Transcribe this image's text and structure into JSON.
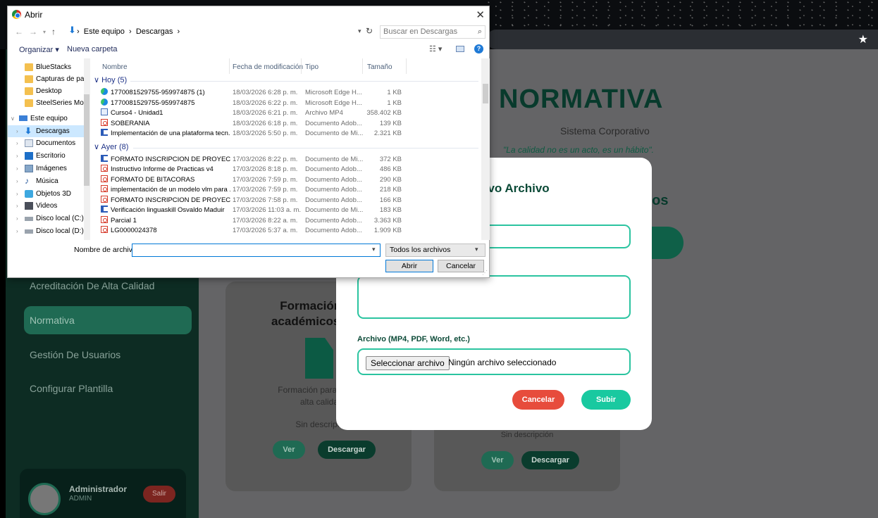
{
  "dialog": {
    "title": "Abrir",
    "path": [
      "Este equipo",
      "Descargas"
    ],
    "search_placeholder": "Buscar en Descargas",
    "toolbar": {
      "organize": "Organizar ▾",
      "new_folder": "Nueva carpeta"
    },
    "nav_items": [
      {
        "label": "BlueStacks",
        "icon": "folder-icon"
      },
      {
        "label": "Capturas de pan",
        "icon": "folder-icon"
      },
      {
        "label": "Desktop",
        "icon": "folder-icon"
      },
      {
        "label": "SteelSeries Mom",
        "icon": "folder-icon"
      },
      {
        "label": "Este equipo",
        "icon": "computer-icon"
      },
      {
        "label": "Descargas",
        "icon": "downloads-icon",
        "selected": true
      },
      {
        "label": "Documentos",
        "icon": "documents-icon"
      },
      {
        "label": "Escritorio",
        "icon": "desktop-icon"
      },
      {
        "label": "Imágenes",
        "icon": "pictures-icon"
      },
      {
        "label": "Música",
        "icon": "music-icon"
      },
      {
        "label": "Objetos 3D",
        "icon": "3d-objects-icon"
      },
      {
        "label": "Videos",
        "icon": "videos-icon"
      },
      {
        "label": "Disco local (C:)",
        "icon": "drive-icon"
      },
      {
        "label": "Disco local (D:)",
        "icon": "drive-icon"
      }
    ],
    "columns": {
      "name": "Nombre",
      "date": "Fecha de modificación",
      "type": "Tipo",
      "size": "Tamaño"
    },
    "groups": [
      {
        "label": "Hoy (5)",
        "files": [
          {
            "name": "1770081529755-959974875 (1)",
            "date": "18/03/2026 6:28 p. m.",
            "type": "Microsoft Edge H...",
            "size": "1 KB",
            "icon": "edge-icon"
          },
          {
            "name": "1770081529755-959974875",
            "date": "18/03/2026 6:22 p. m.",
            "type": "Microsoft Edge H...",
            "size": "1 KB",
            "icon": "edge-icon"
          },
          {
            "name": "Curso4 - Unidad1",
            "date": "18/03/2026 6:21 p. m.",
            "type": "Archivo MP4",
            "size": "358.402 KB",
            "icon": "mp4-icon"
          },
          {
            "name": "SOBERANIA",
            "date": "18/03/2026 6:18 p. m.",
            "type": "Documento Adob...",
            "size": "139 KB",
            "icon": "pdf-icon"
          },
          {
            "name": "Implementación de una plataforma tecn...",
            "date": "18/03/2026 5:50 p. m.",
            "type": "Documento de Mi...",
            "size": "2.321 KB",
            "icon": "word-icon"
          }
        ]
      },
      {
        "label": "Ayer (8)",
        "files": [
          {
            "name": "FORMATO INSCRIPCION DE PROYECTOS ...",
            "date": "17/03/2026 8:22 p. m.",
            "type": "Documento de Mi...",
            "size": "372 KB",
            "icon": "word-icon"
          },
          {
            "name": "Instructivo Informe de Practicas v4",
            "date": "17/03/2026 8:18 p. m.",
            "type": "Documento Adob...",
            "size": "486 KB",
            "icon": "pdf-icon"
          },
          {
            "name": "FORMATO DE BITACORAS",
            "date": "17/03/2026 7:59 p. m.",
            "type": "Documento Adob...",
            "size": "290 KB",
            "icon": "pdf-icon"
          },
          {
            "name": "implementación de un modelo vlm para ...",
            "date": "17/03/2026 7:59 p. m.",
            "type": "Documento Adob...",
            "size": "218 KB",
            "icon": "pdf-icon"
          },
          {
            "name": "FORMATO INSCRIPCION DE PROYECTOS ...",
            "date": "17/03/2026 7:58 p. m.",
            "type": "Documento Adob...",
            "size": "166 KB",
            "icon": "pdf-icon"
          },
          {
            "name": "Verificación linguaskill Osvaldo Maduir",
            "date": "17/03/2026 11:03 a. m.",
            "type": "Documento de Mi...",
            "size": "183 KB",
            "icon": "word-icon"
          },
          {
            "name": "Parcial 1",
            "date": "17/03/2026 8:22 a. m.",
            "type": "Documento Adob...",
            "size": "3.363 KB",
            "icon": "pdf-icon"
          },
          {
            "name": "LG0000024378",
            "date": "17/03/2026 5:37 a. m.",
            "type": "Documento Adob...",
            "size": "1.909 KB",
            "icon": "pdf-icon"
          }
        ]
      }
    ],
    "filename_label": "Nombre de archivo:",
    "filename_value": "",
    "filter": "Todos los archivos",
    "open_label": "Abrir",
    "cancel_label": "Cancelar"
  },
  "app": {
    "title": "NORMATIVA",
    "subtitle": "Sistema Corporativo",
    "quote": "\"La calidad no es un acto, es un hábito\".",
    "section_suffix": "vos",
    "sidebar": {
      "items": [
        {
          "label": "Acreditación De Alta Calidad",
          "active": false
        },
        {
          "label": "Normativa",
          "active": true
        },
        {
          "label": "Gestión De Usuarios",
          "active": false
        },
        {
          "label": "Configurar Plantilla",
          "active": false
        }
      ],
      "user": {
        "name": "Administrador",
        "role": "ADMIN",
        "logout": "Salir"
      }
    },
    "cards": [
      {
        "title": "Formación pa\nacadémicos en a",
        "description": "Formación para pares\nalta calida",
        "no_description": "Sin descripc",
        "view": "Ver",
        "download": "Descargar"
      },
      {
        "no_description": "Sin descripción",
        "view": "Ver",
        "download": "Descargar"
      }
    ]
  },
  "modal": {
    "title": "evo Archivo",
    "file_label": "Archivo (MP4, PDF, Word, etc.)",
    "file_button": "Seleccionar archivo",
    "file_status": "Ningún archivo seleccionado",
    "cancel": "Cancelar",
    "upload": "Subir"
  },
  "colors": {
    "primary": "#0d2c23",
    "accent": "#19c9a0",
    "danger": "#e74c3c"
  }
}
